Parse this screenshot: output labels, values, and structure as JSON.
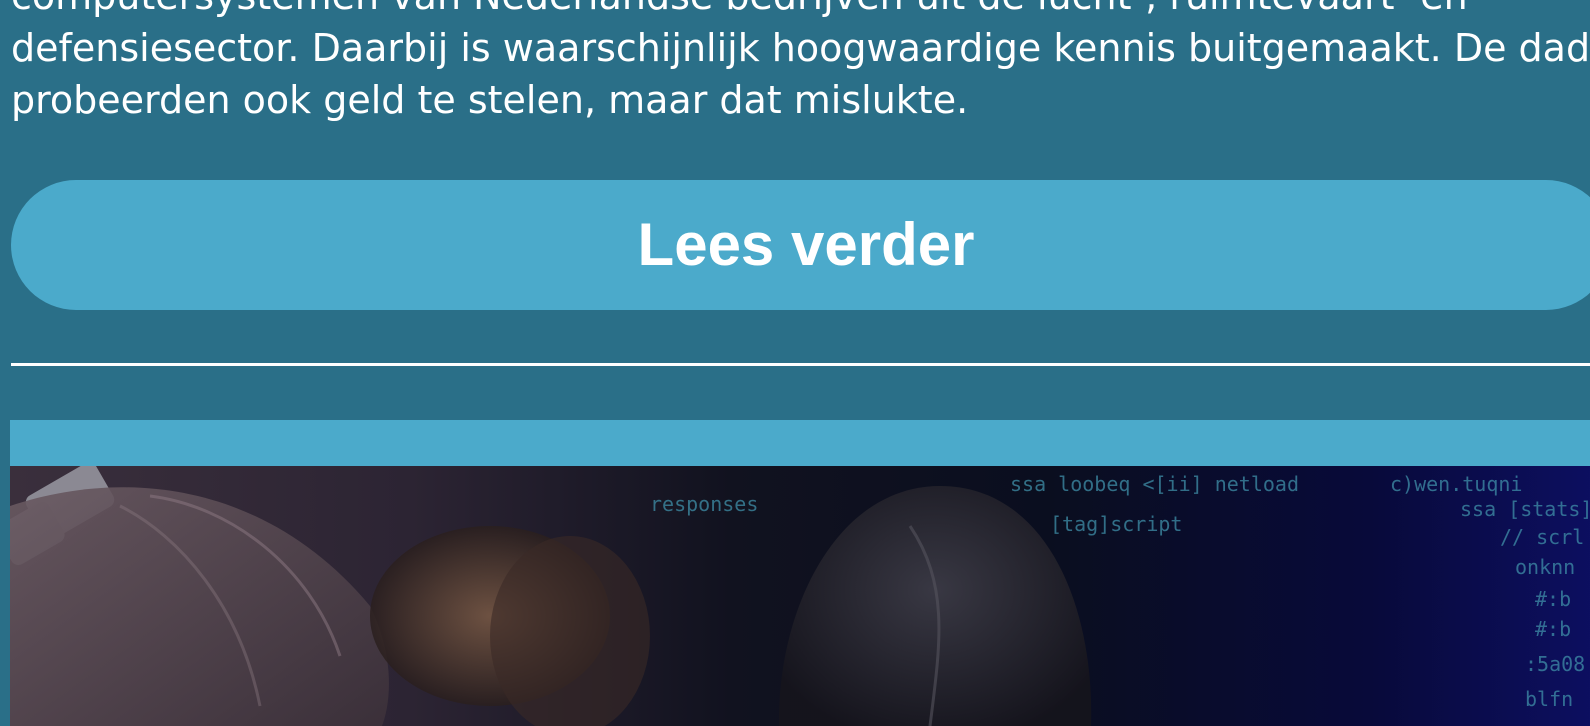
{
  "article": {
    "lines": [
      "computersystemen van Nederlandse bedrijven uit de lucht-, ruimtevaart- en",
      "defensiesector. Daarbij is waarschijnlijk hoogwaardige kennis buitgemaakt. De daders",
      "probeerden ook geld te stelen, maar dat mislukte."
    ]
  },
  "read_more": {
    "label": "Lees verder"
  },
  "card": {
    "image_code_lines": [
      "responses",
      "ssa loobeq <[ii] netload",
      "[tag]script",
      "c)wen.tuqni",
      "ssa [stats]",
      "// scrl",
      "onknn",
      "#:b",
      "#:b",
      ":5a08",
      "blfn"
    ]
  },
  "colors": {
    "background": "#2a6f88",
    "button": "#4baacb",
    "text": "#ffffff"
  }
}
